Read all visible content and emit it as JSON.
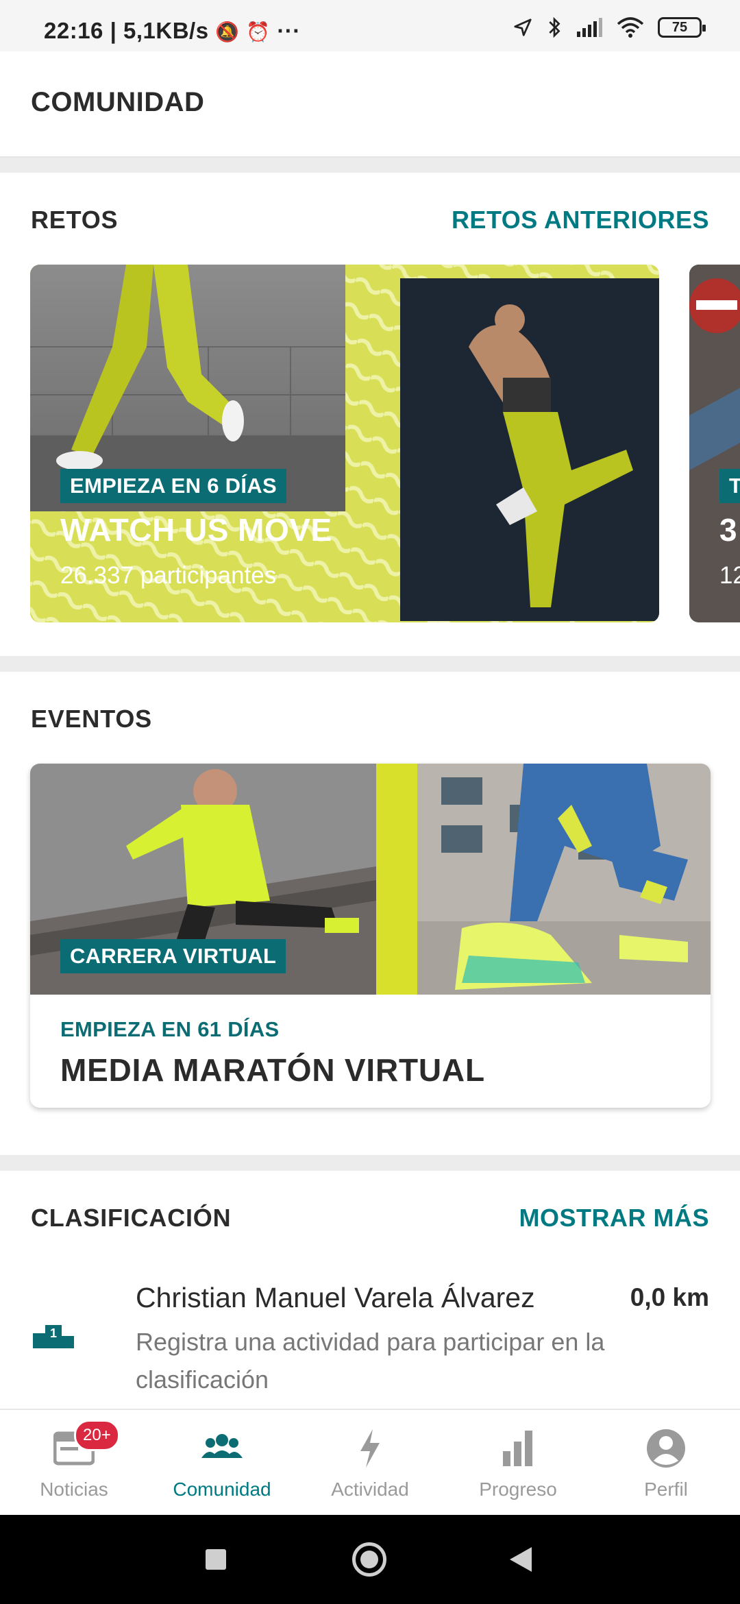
{
  "status_bar": {
    "time": "22:16",
    "speed": "5,1KB/s",
    "battery": "75"
  },
  "header": {
    "title": "COMUNIDAD"
  },
  "challenges": {
    "title": "RETOS",
    "link": "RETOS ANTERIORES",
    "card": {
      "tag": "EMPIEZA EN 6 DÍAS",
      "name": "WATCH US MOVE",
      "participants": "26.337 participantes"
    },
    "peek_card": {
      "tag": "T",
      "name": "3",
      "participants": "12"
    }
  },
  "events": {
    "title": "EVENTOS",
    "card": {
      "tag": "CARRERA VIRTUAL",
      "starts": "EMPIEZA EN 61 DÍAS",
      "name": "MEDIA MARATÓN VIRTUAL"
    }
  },
  "leaderboard": {
    "title": "CLASIFICACIÓN",
    "link": "MOSTRAR MÁS",
    "entry": {
      "rank": "1",
      "name": "Christian Manuel Varela Álvarez",
      "distance": "0,0 km",
      "hint_line1": "Registra una actividad para participar en la",
      "hint_line2": "clasificación"
    }
  },
  "nav": {
    "items": [
      {
        "label": "Noticias",
        "icon": "news-icon",
        "badge": "20+"
      },
      {
        "label": "Comunidad",
        "icon": "community-icon"
      },
      {
        "label": "Actividad",
        "icon": "bolt-icon"
      },
      {
        "label": "Progreso",
        "icon": "bar-chart-icon"
      },
      {
        "label": "Perfil",
        "icon": "profile-icon"
      }
    ],
    "active": "Comunidad"
  },
  "colors": {
    "accent": "#007a82",
    "tag_bg": "#0b6d73",
    "badge": "#d9283f",
    "neon": "#d4e23a"
  }
}
